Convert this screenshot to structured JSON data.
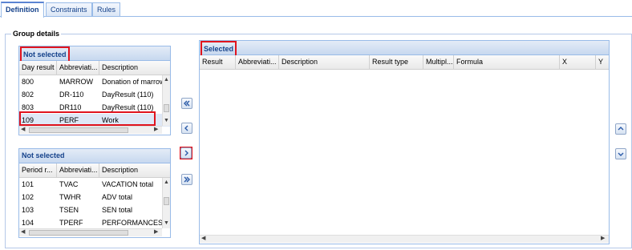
{
  "tabs": [
    {
      "label": "Definition"
    },
    {
      "label": "Constraints"
    },
    {
      "label": "Rules"
    }
  ],
  "group_details": {
    "legend": "Group details",
    "day_grid": {
      "title": "Not selected",
      "columns": [
        "Day result",
        "Abbreviati...",
        "Description"
      ],
      "rows": [
        [
          "800",
          "MARROW",
          "Donation of marrow"
        ],
        [
          "802",
          "DR-110",
          "DayResult (110)"
        ],
        [
          "803",
          "DR110",
          "DayResult (110)"
        ],
        [
          "109",
          "PERF",
          "Work"
        ]
      ]
    },
    "period_grid": {
      "title": "Not selected",
      "columns": [
        "Period r...",
        "Abbreviati...",
        "Description"
      ],
      "rows": [
        [
          "101",
          "TVAC",
          "VACATION total"
        ],
        [
          "102",
          "TWHR",
          "ADV total"
        ],
        [
          "103",
          "TSEN",
          "SEN total"
        ],
        [
          "104",
          "TPERF",
          "PERFORMANCES to"
        ]
      ]
    },
    "selected_grid": {
      "title": "Selected",
      "columns": [
        "Result",
        "Abbreviati...",
        "Description",
        "Result type",
        "Multipl...",
        "Formula",
        "X",
        "Y"
      ]
    },
    "transfer_buttons": [
      "add-all-icon",
      "remove-icon",
      "add-icon",
      "add-all-right-icon"
    ],
    "order_buttons": [
      "move-up-icon",
      "move-down-icon"
    ]
  }
}
